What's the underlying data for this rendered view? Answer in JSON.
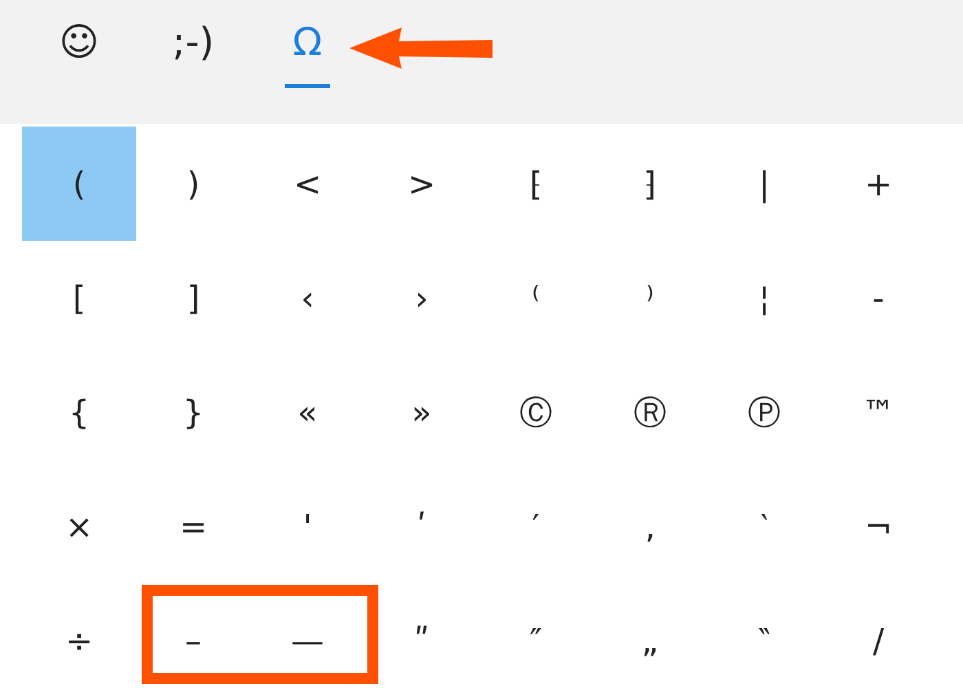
{
  "tabs": [
    {
      "label": "☺",
      "selected": false
    },
    {
      "label": ";-)",
      "selected": false
    },
    {
      "label": "Ω",
      "selected": true
    }
  ],
  "symbols": [
    {
      "char": "(",
      "selected": true
    },
    {
      "char": ")",
      "selected": false
    },
    {
      "char": "<",
      "selected": false
    },
    {
      "char": ">",
      "selected": false
    },
    {
      "char": "⁅",
      "selected": false
    },
    {
      "char": "⁆",
      "selected": false
    },
    {
      "char": "|",
      "selected": false
    },
    {
      "char": "+",
      "selected": false
    },
    {
      "char": "[",
      "selected": false
    },
    {
      "char": "]",
      "selected": false
    },
    {
      "char": "‹",
      "selected": false
    },
    {
      "char": "›",
      "selected": false
    },
    {
      "char": "⁽",
      "selected": false
    },
    {
      "char": "⁾",
      "selected": false
    },
    {
      "char": "¦",
      "selected": false
    },
    {
      "char": "-",
      "selected": false
    },
    {
      "char": "{",
      "selected": false
    },
    {
      "char": "}",
      "selected": false
    },
    {
      "char": "«",
      "selected": false
    },
    {
      "char": "»",
      "selected": false
    },
    {
      "char": "Ⓒ",
      "selected": false
    },
    {
      "char": "Ⓡ",
      "selected": false
    },
    {
      "char": "Ⓟ",
      "selected": false
    },
    {
      "char": "™",
      "selected": false
    },
    {
      "char": "×",
      "selected": false
    },
    {
      "char": "=",
      "selected": false
    },
    {
      "char": "'",
      "selected": false
    },
    {
      "char": "ʹ",
      "selected": false
    },
    {
      "char": "′",
      "selected": false
    },
    {
      "char": "‚",
      "selected": false
    },
    {
      "char": "‵",
      "selected": false
    },
    {
      "char": "¬",
      "selected": false
    },
    {
      "char": "÷",
      "selected": false
    },
    {
      "char": "–",
      "selected": false
    },
    {
      "char": "—",
      "selected": false
    },
    {
      "char": "ʺ",
      "selected": false
    },
    {
      "char": "″",
      "selected": false
    },
    {
      "char": "„",
      "selected": false
    },
    {
      "char": "‶",
      "selected": false
    },
    {
      "char": "/",
      "selected": false
    }
  ]
}
